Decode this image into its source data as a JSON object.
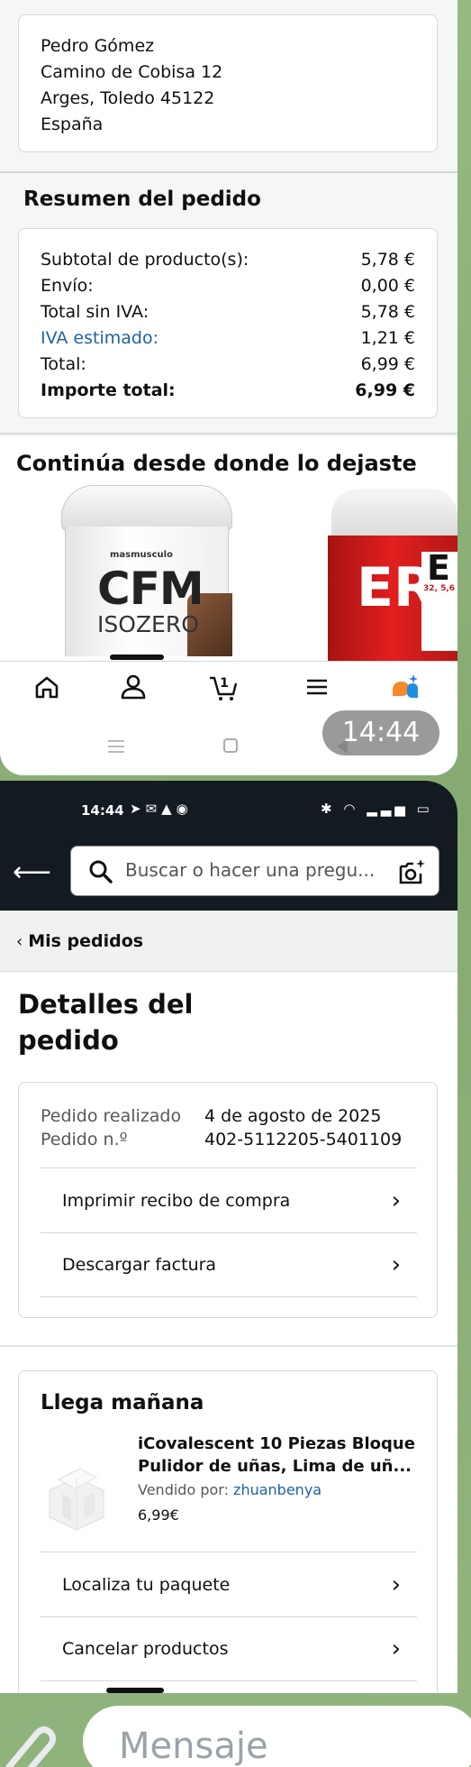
{
  "top": {
    "address": [
      "Pedro Gómez",
      "Camino de Cobisa 12",
      "Arges, Toledo 45122",
      "España"
    ],
    "summary_title": "Resumen del pedido",
    "summary_rows": [
      {
        "label": "Subtotal de producto(s):",
        "value": "5,78 €"
      },
      {
        "label": "Envío:",
        "value": "0,00 €"
      },
      {
        "label": "Total sin IVA:",
        "value": "5,78 €"
      },
      {
        "label": "IVA estimado:",
        "value": "1,21 €"
      },
      {
        "label": "Total:",
        "value": "6,99 €"
      },
      {
        "label": "Importe total:",
        "value": "6,99 €"
      }
    ],
    "continue_title": "Continúa desde donde lo dejaste",
    "product1": {
      "brand": "masmusculo",
      "name1": "CFM",
      "name2": "ISOZERO"
    },
    "product2": {
      "big": "ERO",
      "side": "ESSIONAL",
      "label_big": "E",
      "label_small": "32, 5,6"
    },
    "cart_count": "1",
    "bubble_time": "14:44"
  },
  "status": {
    "time": "14:44"
  },
  "search": {
    "placeholder": "Buscar o hacer una pregu..."
  },
  "breadcrumb": "Mis pedidos",
  "details_title": "Detalles del pedido",
  "order": {
    "placed_label": "Pedido realizado",
    "placed_value": "4 de agosto de 2025",
    "number_label": "Pedido n.º",
    "number_value": "402-5112205-5401109",
    "links": [
      "Imprimir recibo de compra",
      "Descargar factura"
    ]
  },
  "shipment": {
    "title": "Llega mañana",
    "item_line1": "iCovalescent 10 Piezas Bloque",
    "item_line2": "Pulidor de uñas, Lima de uñ...",
    "seller_label": "Vendido por:",
    "seller": "zhuanbenya",
    "price": "6,99€",
    "links": [
      "Localiza tu paquete",
      "Cancelar productos"
    ]
  },
  "message": {
    "placeholder": "Mensaje"
  }
}
